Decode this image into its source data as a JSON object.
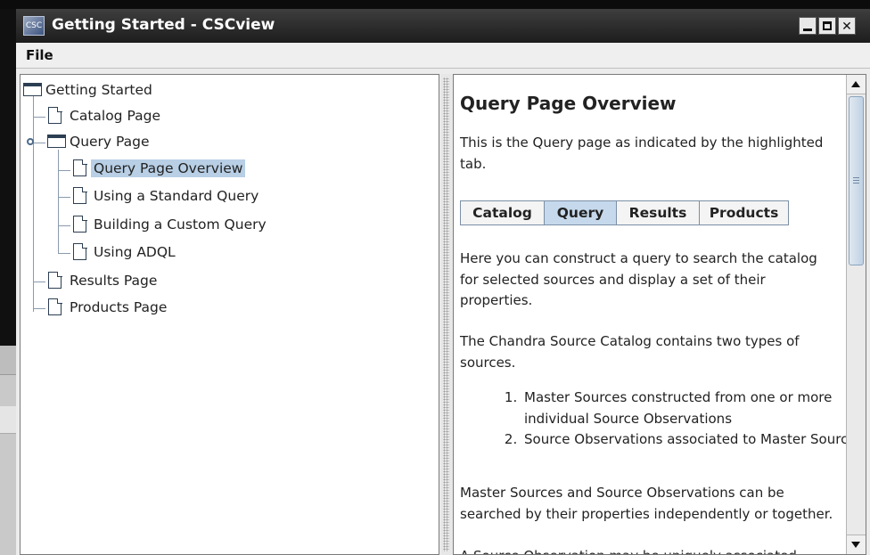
{
  "window": {
    "title": "Getting Started - CSCview",
    "menu": {
      "file": "File"
    }
  },
  "tree": {
    "root": "Getting Started",
    "items": [
      {
        "label": "Catalog Page"
      },
      {
        "label": "Query Page"
      },
      {
        "label": "Query Page Overview",
        "selected": true
      },
      {
        "label": "Using a Standard Query"
      },
      {
        "label": "Building a Custom Query"
      },
      {
        "label": "Using ADQL"
      },
      {
        "label": "Results Page"
      },
      {
        "label": "Products Page"
      }
    ]
  },
  "content": {
    "heading": "Query Page Overview",
    "intro": "This is the Query page as indicated by the highlighted tab.",
    "tabs": [
      "Catalog",
      "Query",
      "Results",
      "Products"
    ],
    "active_tab": "Query",
    "para1": "Here you can construct a query to search the catalog for selected sources and display a set of their properties.",
    "para2": "The Chandra Source Catalog contains two types of sources.",
    "list": [
      "Master Sources constructed from one or more individual Source Observations",
      "Source Observations associated to Master Sources."
    ],
    "para3": "Master Sources and Source Observations can be searched by their properties independently or together.",
    "para4_partial": "A Source Observation may be uniquely associated"
  },
  "colors": {
    "selection": "#b8cfe5",
    "active_tab": "#c6d9ec",
    "titlebar": "#2a2a2a"
  }
}
